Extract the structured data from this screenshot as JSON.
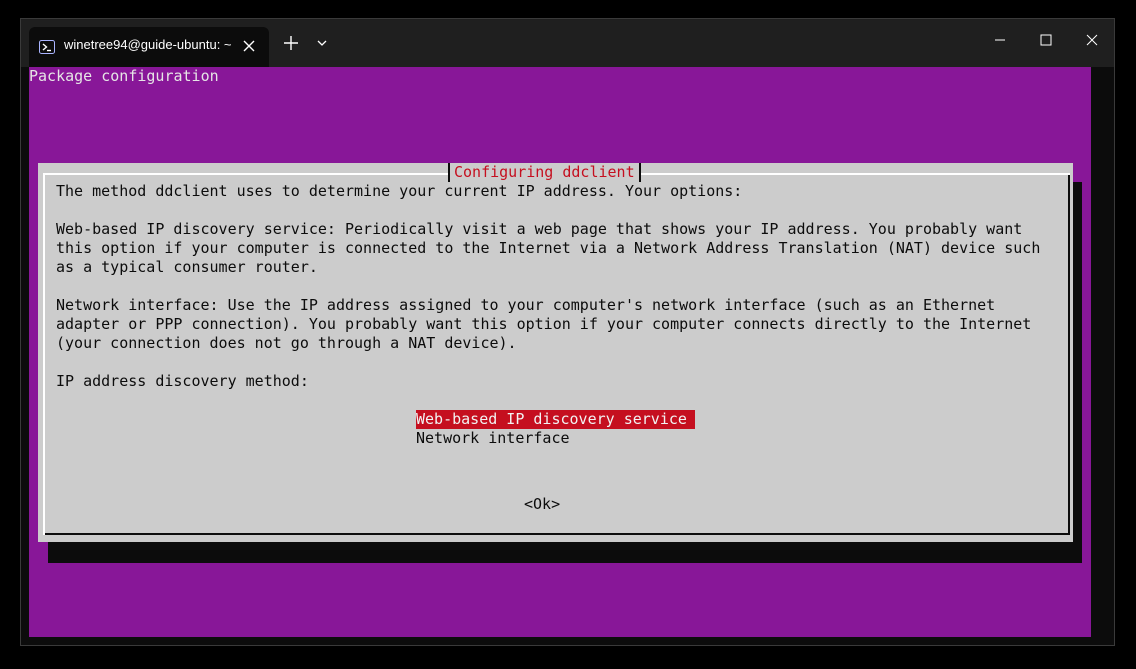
{
  "window": {
    "tab_title": "winetree94@guide-ubuntu: ~"
  },
  "terminal": {
    "header": "Package configuration",
    "dialog": {
      "title": "Configuring ddclient",
      "lines": [
        "The method ddclient uses to determine your current IP address. Your options:",
        "",
        "Web-based IP discovery service: Periodically visit a web page that shows your IP address. You probably want",
        "this option if your computer is connected to the Internet via a Network Address Translation (NAT) device such",
        "as a typical consumer router.",
        "",
        "Network interface: Use the IP address assigned to your computer's network interface (such as an Ethernet",
        "adapter or PPP connection). You probably want this option if your computer connects directly to the Internet",
        "(your connection does not go through a NAT device).",
        "",
        "IP address discovery method:"
      ],
      "options": [
        {
          "label": "Web-based IP discovery service",
          "selected": true
        },
        {
          "label": "Network interface",
          "selected": false
        }
      ],
      "ok_label": "<Ok>"
    }
  },
  "colors": {
    "background": "#881798",
    "dialog_bg": "#cccccc",
    "highlight": "#c50f1f"
  }
}
